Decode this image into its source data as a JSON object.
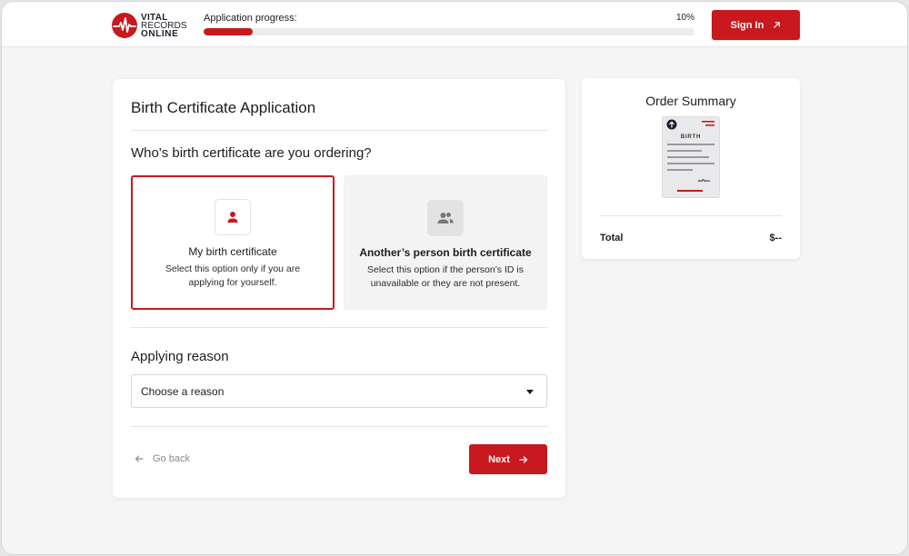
{
  "header": {
    "logo": {
      "line1": "VITAL",
      "line2": "RECORDS",
      "line3": "ONLINE"
    },
    "progress_label": "Application progress:",
    "progress_text": "10%",
    "progress_value": 0.1,
    "signin_label": "Sign In"
  },
  "form": {
    "title": "Birth Certificate Application",
    "question": "Who's birth certificate are you ordering?",
    "options": [
      {
        "title": "My birth certificate",
        "description": "Select this option only if you are applying for yourself.",
        "icon": "person-icon",
        "selected": true
      },
      {
        "title": "Another’s person birth certificate",
        "description": "Select this option if the person’s ID is unavailable or they are not present.",
        "icon": "people-icon",
        "selected": false
      }
    ],
    "reason_title": "Applying reason",
    "reason_value": "Choose a reason",
    "back_label": "Go back",
    "next_label": "Next"
  },
  "summary": {
    "title": "Order Summary",
    "document_label": "BIRTH",
    "total_label": "Total",
    "total_value": "$--"
  },
  "colors": {
    "accent": "#c8191e",
    "background": "#f5f5f6",
    "card": "#ffffff"
  }
}
